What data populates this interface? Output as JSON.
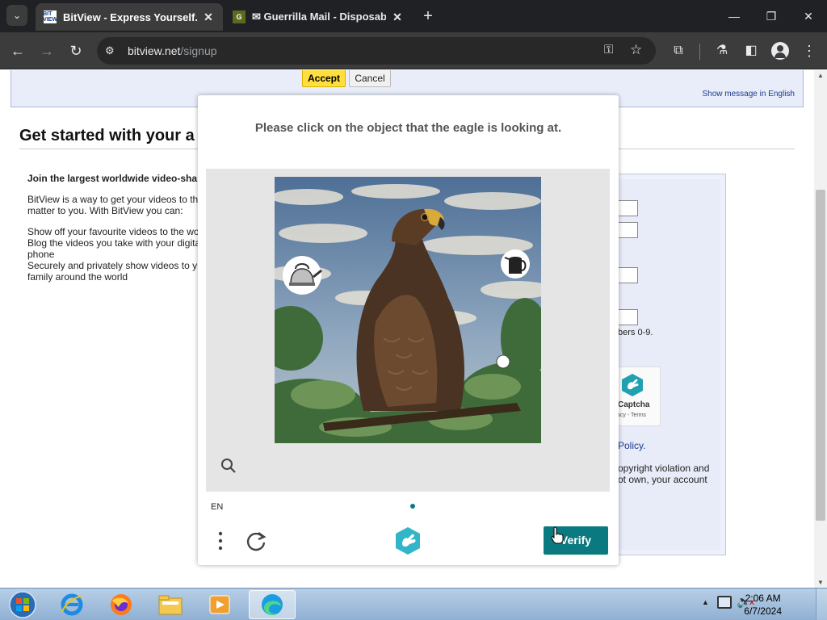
{
  "browser": {
    "tabs": [
      {
        "title": "BitView - Express Yourself.",
        "favicon": "BitView",
        "active": true
      },
      {
        "title": "✉ Guerrilla Mail - Disposable T",
        "favicon": "G",
        "active": false
      }
    ],
    "url_domain": "bitview.net",
    "url_path": "/signup"
  },
  "page": {
    "message_bar": {
      "accept_label": "Accept",
      "cancel_label": "Cancel",
      "show_english_label": "Show message in English"
    },
    "title": "Get started with your a",
    "intro_heading": "Join the largest worldwide video-sha",
    "intro_lines": [
      "BitView is a way to get your videos to th",
      "matter to you. With BitView you can:"
    ],
    "bullet_lines": [
      "Show off your favourite videos to the wo",
      "Blog the videos you take with your digita",
      "phone",
      "Securely and privately show videos to y",
      "family around the world"
    ],
    "form_fragments": {
      "numbers_hint": "bers 0-9.",
      "captcha_name": "Captcha",
      "captcha_links": "acy - Terms",
      "policy_link": "Policy.",
      "copyright_line1": "opyright violation and",
      "copyright_line2": "ot own, your account"
    }
  },
  "captcha": {
    "prompt": "Please click on the object that the eagle is looking at.",
    "language": "EN",
    "verify_label": "Verify",
    "colors": {
      "accent": "#0b7a80"
    }
  },
  "taskbar": {
    "apps": [
      "start-orb",
      "internet-explorer",
      "firefox",
      "file-explorer",
      "media-player",
      "edge"
    ],
    "time": "2:06 AM",
    "date": "6/7/2024"
  }
}
